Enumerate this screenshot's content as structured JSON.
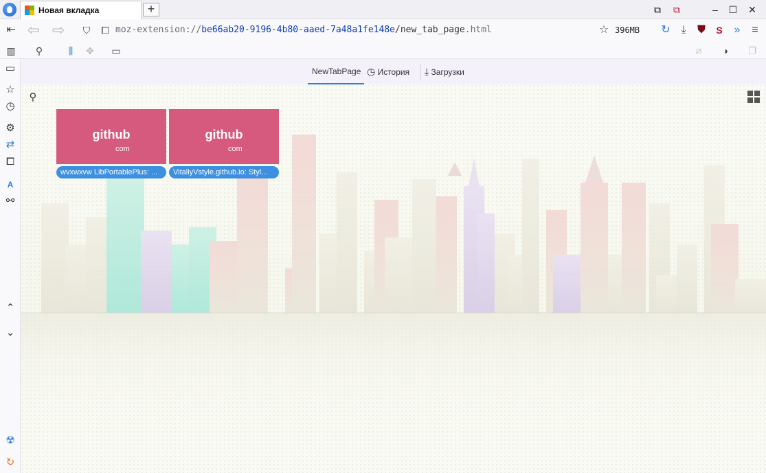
{
  "tab": {
    "title": "Новая вкладка"
  },
  "titlebar_icons": [
    "container-tab-icon",
    "private-container-icon",
    "minimize-icon",
    "maximize-icon",
    "close-icon"
  ],
  "navbar": {
    "url": {
      "scheme": "moz-extension://",
      "host": "be66ab20-9196-4b80-aaed-7a48a1fe148e",
      "path": "/new_tab_page",
      "ext": ".html"
    },
    "memory": "396MB"
  },
  "page_tabs": [
    {
      "label": "NewTabPage",
      "active": true
    },
    {
      "label": "История",
      "active": false
    },
    {
      "label": "Загрузки",
      "active": false
    }
  ],
  "tiles": [
    {
      "name": "github",
      "tld": "com",
      "caption": "wvxwxvw LibPortablePlus: ..."
    },
    {
      "name": "github",
      "tld": "com",
      "caption": "VitaliyVstyle.github.io: Styl..."
    }
  ],
  "colors": {
    "tile_bg": "#d55a7d",
    "caption_bg": "#3d8fe0",
    "accent": "#2e7fd6"
  }
}
